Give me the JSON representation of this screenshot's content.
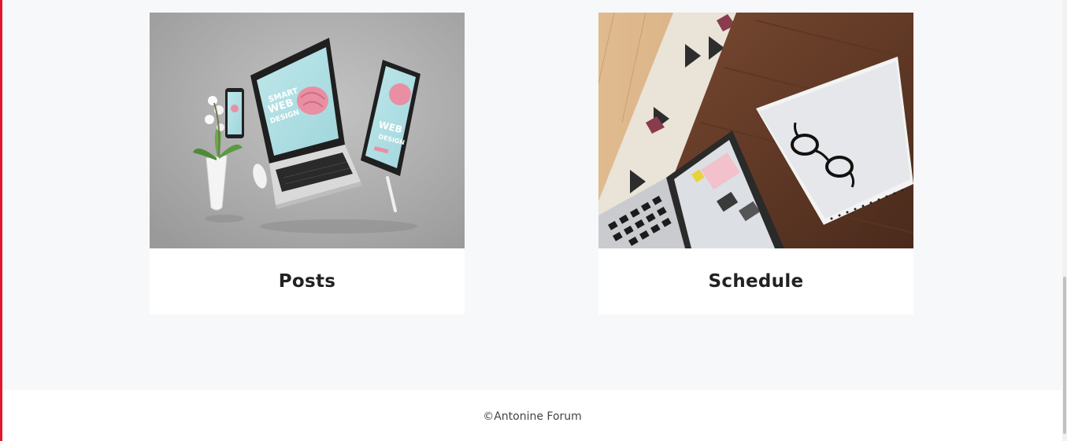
{
  "cards": [
    {
      "title": "Posts"
    },
    {
      "title": "Schedule"
    }
  ],
  "footer": {
    "copyright": "©Antonine Forum"
  },
  "colors": {
    "accent": "#e3172b",
    "background": "#f7f8fa",
    "card": "#ffffff",
    "title_text": "#222222"
  }
}
